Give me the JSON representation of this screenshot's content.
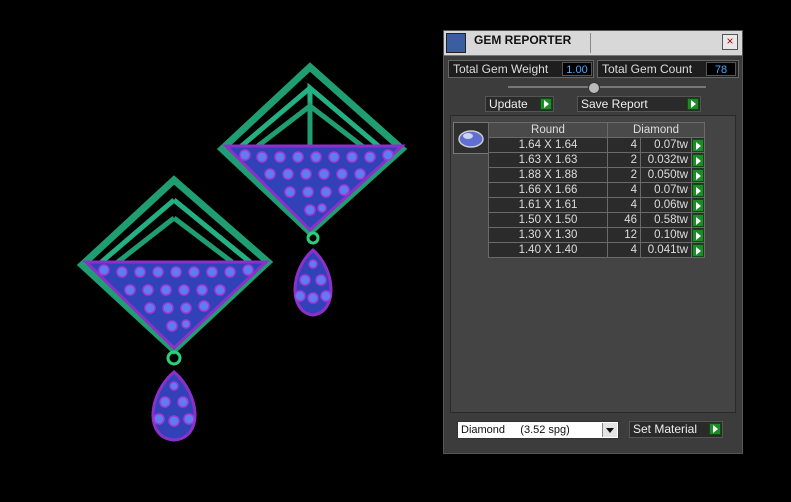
{
  "window": {
    "title": "GEM REPORTER",
    "close_glyph": "×"
  },
  "stats": {
    "weight_label": "Total Gem Weight",
    "weight_value": "1.00",
    "count_label": "Total Gem Count",
    "count_value": "78"
  },
  "buttons": {
    "update": "Update",
    "save_report": "Save Report",
    "set_material": "Set Material"
  },
  "table": {
    "headers": [
      "Round",
      "Diamond"
    ],
    "rows": [
      {
        "size": "1.64 X 1.64",
        "count": "4",
        "weight": "0.07tw"
      },
      {
        "size": "1.63 X 1.63",
        "count": "2",
        "weight": "0.032tw"
      },
      {
        "size": "1.88 X 1.88",
        "count": "2",
        "weight": "0.050tw"
      },
      {
        "size": "1.66 X 1.66",
        "count": "4",
        "weight": "0.07tw"
      },
      {
        "size": "1.61 X 1.61",
        "count": "4",
        "weight": "0.06tw"
      },
      {
        "size": "1.50 X 1.50",
        "count": "46",
        "weight": "0.58tw"
      },
      {
        "size": "1.30 X 1.30",
        "count": "12",
        "weight": "0.10tw"
      },
      {
        "size": "1.40 X 1.40",
        "count": "4",
        "weight": "0.041tw"
      }
    ]
  },
  "material_select": {
    "selected": "Diamond     (3.52 spg)"
  },
  "colors": {
    "metal": "#1f9e74",
    "stone": "#3d4fd8",
    "prong": "#a13ad8"
  },
  "icons": {
    "app": "gem-reporter-icon",
    "thumb": "round-gem-icon",
    "go": "green-play-arrow-icon"
  }
}
